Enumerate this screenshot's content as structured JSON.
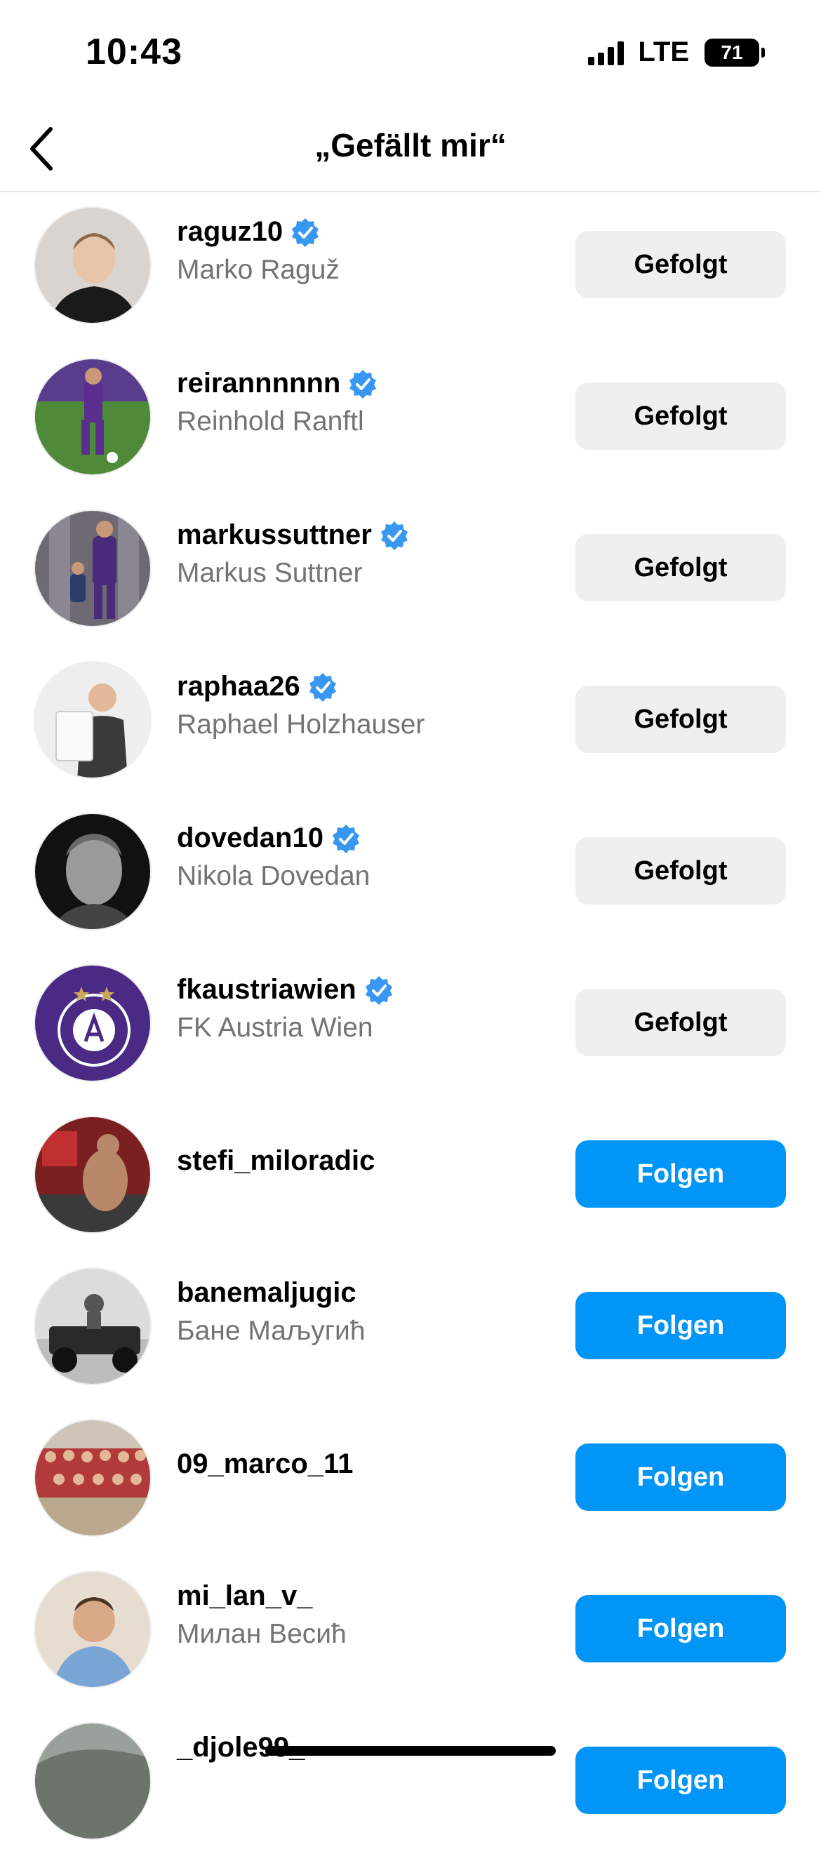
{
  "status": {
    "time": "10:43",
    "network": "LTE",
    "battery": "71"
  },
  "header": {
    "title": "„Gefällt mir“"
  },
  "colors": {
    "accent": "#0095f6",
    "verified": "#3897f0",
    "muted": "#737373"
  },
  "likes": [
    {
      "username": "raguz10",
      "fullname": "Marko Raguž",
      "verified": true,
      "button": "Gefolgt",
      "following": true
    },
    {
      "username": "reirannnnnn",
      "fullname": "Reinhold Ranftl",
      "verified": true,
      "button": "Gefolgt",
      "following": true
    },
    {
      "username": "markussuttner",
      "fullname": "Markus Suttner",
      "verified": true,
      "button": "Gefolgt",
      "following": true
    },
    {
      "username": "raphaa26",
      "fullname": "Raphael Holzhauser",
      "verified": true,
      "button": "Gefolgt",
      "following": true
    },
    {
      "username": "dovedan10",
      "fullname": "Nikola Dovedan",
      "verified": true,
      "button": "Gefolgt",
      "following": true
    },
    {
      "username": "fkaustriawien",
      "fullname": "FK Austria Wien",
      "verified": true,
      "button": "Gefolgt",
      "following": true
    },
    {
      "username": "stefi_miloradic",
      "fullname": "",
      "verified": false,
      "button": "Folgen",
      "following": false
    },
    {
      "username": "banemaljugic",
      "fullname": "Бане Маљугић",
      "verified": false,
      "button": "Folgen",
      "following": false
    },
    {
      "username": "09_marco_11",
      "fullname": "",
      "verified": false,
      "button": "Folgen",
      "following": false
    },
    {
      "username": "mi_lan_v_",
      "fullname": "Милан Весић",
      "verified": false,
      "button": "Folgen",
      "following": false
    },
    {
      "username": "_djole99_",
      "fullname": "",
      "verified": false,
      "button": "Folgen",
      "following": false
    }
  ]
}
